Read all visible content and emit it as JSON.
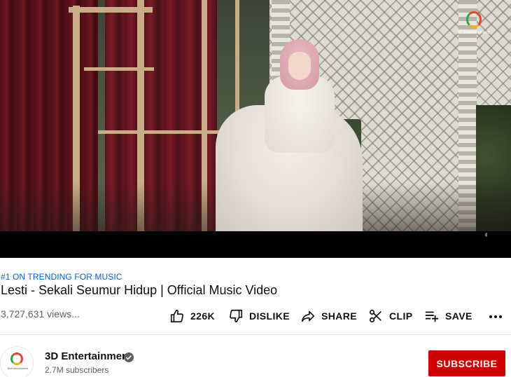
{
  "video": {
    "watermark_text": "3D Entertainment",
    "corner_glyph": "◐"
  },
  "meta": {
    "hashtag": "#1 ON TRENDING FOR MUSIC",
    "title": "Lesti - Sekali Seumur Hidup | Official Music Video",
    "views": "3,727,631 views..."
  },
  "actions": {
    "like_count": "226K",
    "dislike_label": "DISLIKE",
    "share_label": "SHARE",
    "clip_label": "CLIP",
    "save_label": "SAVE"
  },
  "channel": {
    "name": "3D Entertainment",
    "subscribers": "2.7M subscribers",
    "avatar_text": "3Dentertainment",
    "subscribe_label": "SUBSCRIBE"
  },
  "colors": {
    "link": "#065fd4",
    "subscribe": "#cc0000",
    "secondary_text": "#606060"
  },
  "icons": {
    "like": "thumbs-up-icon",
    "dislike": "thumbs-down-icon",
    "share": "share-arrow-icon",
    "clip": "scissors-icon",
    "save": "playlist-add-icon",
    "more": "more-horizontal-icon",
    "verified": "verified-check-icon"
  }
}
